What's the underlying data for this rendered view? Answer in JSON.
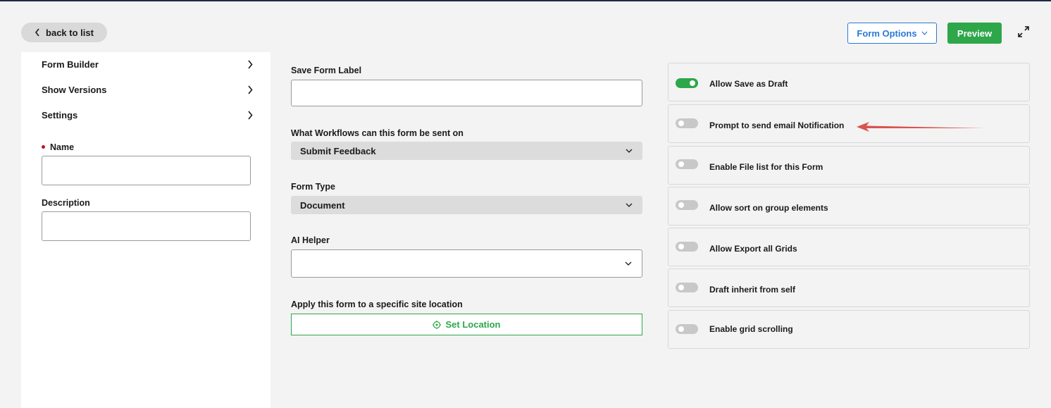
{
  "topbar": {
    "back_label": "back to list",
    "form_options_label": "Form Options",
    "preview_label": "Preview"
  },
  "left_nav": {
    "items": [
      {
        "label": "Form Builder"
      },
      {
        "label": "Show Versions"
      },
      {
        "label": "Settings"
      }
    ],
    "name_label": "Name",
    "name_value": "",
    "description_label": "Description",
    "description_value": ""
  },
  "middle": {
    "save_form_label": "Save Form Label",
    "save_form_value": "",
    "workflows_label": "What Workflows can this form be sent on",
    "workflows_value": "Submit Feedback",
    "form_type_label": "Form Type",
    "form_type_value": "Document",
    "ai_helper_label": "AI Helper",
    "ai_helper_value": "",
    "location_label": "Apply this form to a specific site location",
    "set_location_label": "Set Location"
  },
  "toggles": [
    {
      "label": "Allow Save as Draft",
      "on": true
    },
    {
      "label": "Prompt to send email Notification",
      "on": false
    },
    {
      "label": "Enable File list for this Form",
      "on": false
    },
    {
      "label": "Allow sort on group elements",
      "on": false
    },
    {
      "label": "Allow Export all Grids",
      "on": false
    },
    {
      "label": "Draft inherit from self",
      "on": false
    },
    {
      "label": "Enable grid scrolling",
      "on": false
    }
  ],
  "colors": {
    "accent_blue": "#2b79d6",
    "accent_green": "#2ea64a",
    "required_red": "#c0141e",
    "annotation_arrow": "#d9534f"
  }
}
